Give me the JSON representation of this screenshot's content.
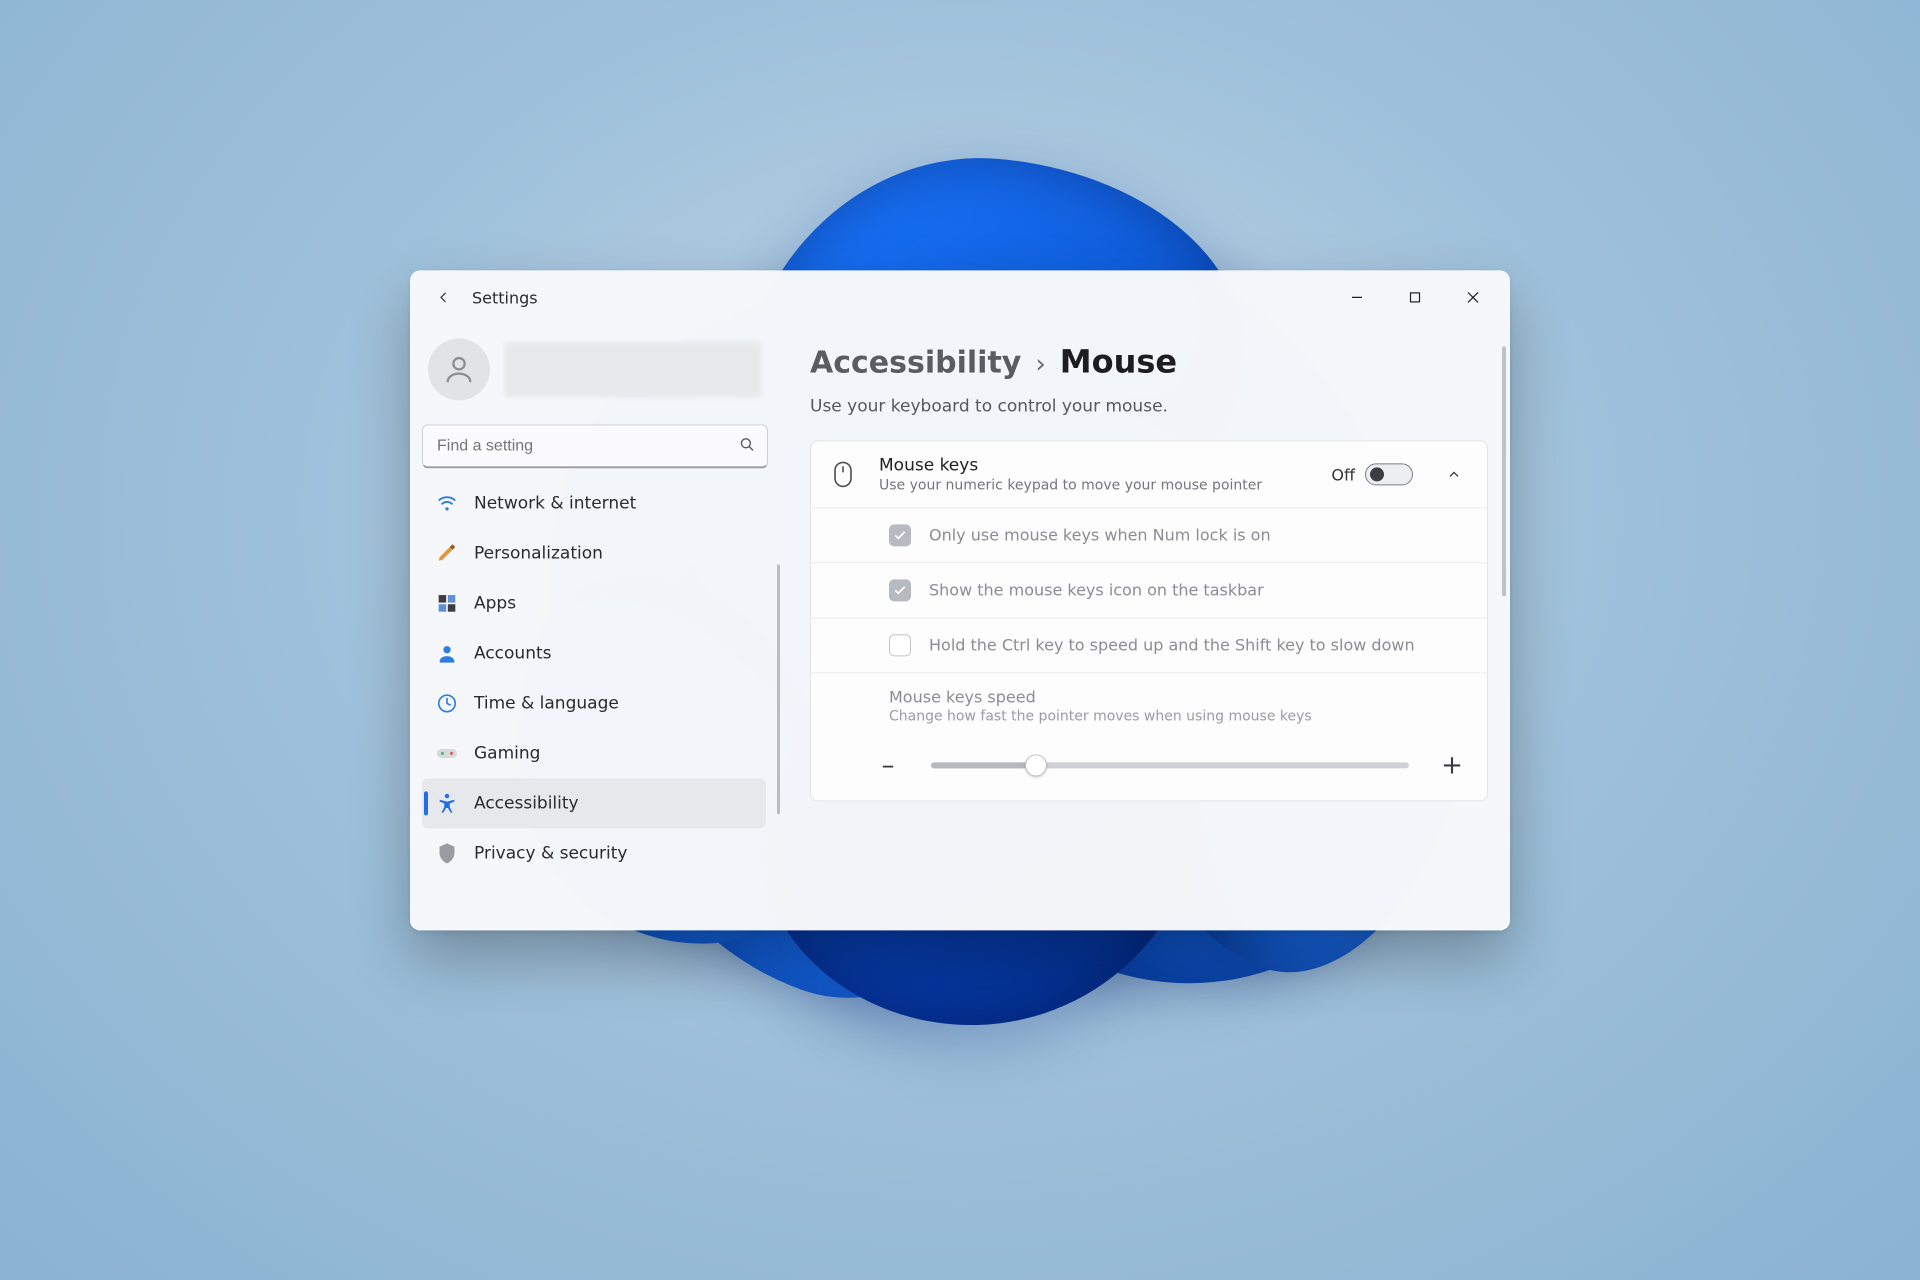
{
  "window": {
    "title": "Settings"
  },
  "search": {
    "placeholder": "Find a setting"
  },
  "sidebar": {
    "items": [
      {
        "label": "Network & internet"
      },
      {
        "label": "Personalization"
      },
      {
        "label": "Apps"
      },
      {
        "label": "Accounts"
      },
      {
        "label": "Time & language"
      },
      {
        "label": "Gaming"
      },
      {
        "label": "Accessibility"
      },
      {
        "label": "Privacy & security"
      }
    ]
  },
  "breadcrumb": {
    "parent": "Accessibility",
    "separator": "›",
    "current": "Mouse"
  },
  "page": {
    "subtitle": "Use your keyboard to control your mouse."
  },
  "mouseKeys": {
    "title": "Mouse keys",
    "description": "Use your numeric keypad to move your mouse pointer",
    "stateLabel": "Off",
    "options": {
      "numLock": "Only use mouse keys when Num lock is on",
      "taskbarIcon": "Show the mouse keys icon on the taskbar",
      "ctrlShift": "Hold the Ctrl key to speed up and the Shift key to slow down"
    },
    "speed": {
      "title": "Mouse keys speed",
      "description": "Change how fast the pointer moves when using mouse keys",
      "minus": "–",
      "plus": "+",
      "valuePercent": 22
    }
  }
}
